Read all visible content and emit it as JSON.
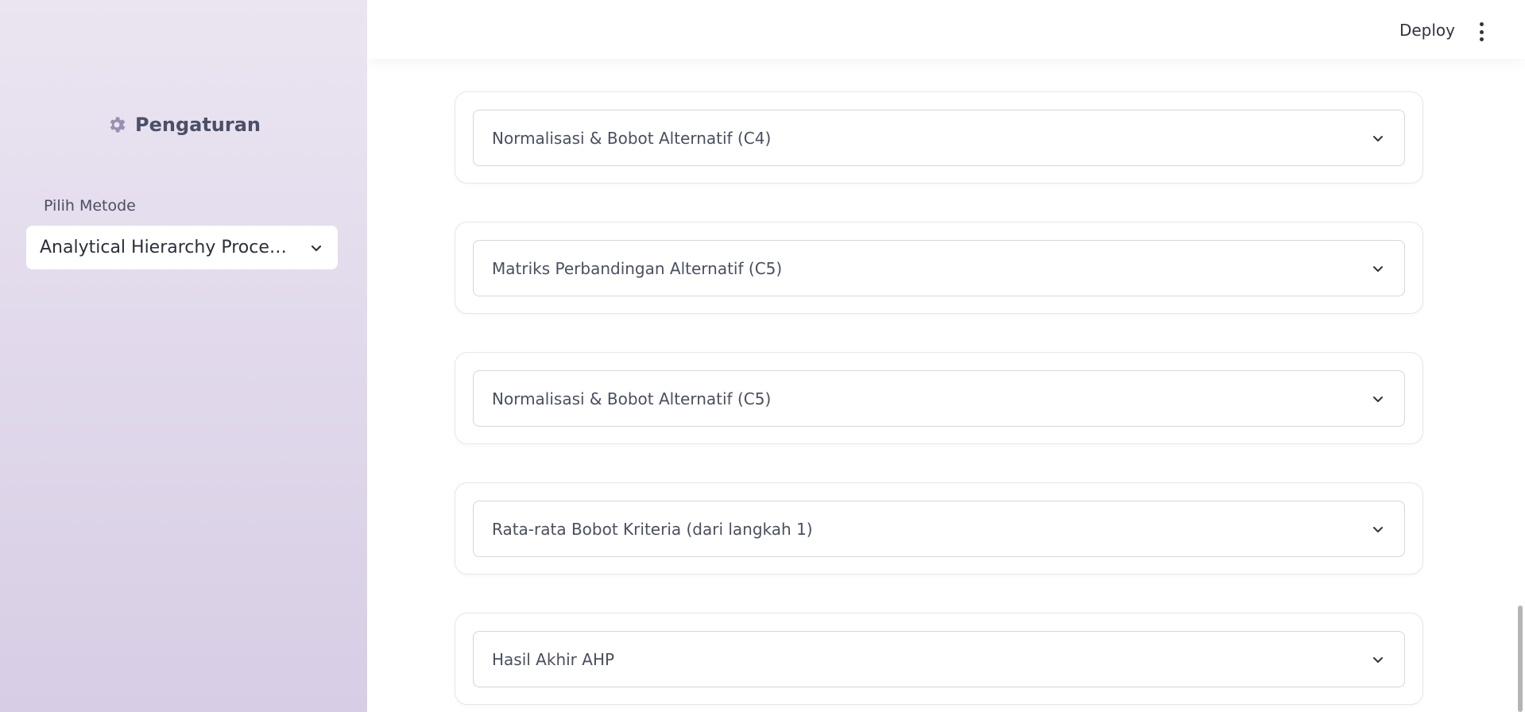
{
  "sidebar": {
    "header": {
      "icon": "gear-icon",
      "title": "Pengaturan"
    },
    "method_select": {
      "label": "Pilih Metode",
      "value": "Analytical Hierarchy Process (AHP)"
    }
  },
  "topbar": {
    "deploy_label": "Deploy",
    "menu_icon": "kebab-menu-icon"
  },
  "expanders": [
    {
      "label": "Normalisasi & Bobot Alternatif (C4)"
    },
    {
      "label": "Matriks Perbandingan Alternatif (C5)"
    },
    {
      "label": "Normalisasi & Bobot Alternatif (C5)"
    },
    {
      "label": "Rata-rata Bobot Kriteria (dari langkah 1)"
    },
    {
      "label": "Hasil Akhir AHP"
    }
  ],
  "colors": {
    "sidebar_top": "#ebe5f1",
    "sidebar_bottom": "#d7cde5",
    "text": "#31333f",
    "muted_text": "#4a4f60"
  }
}
